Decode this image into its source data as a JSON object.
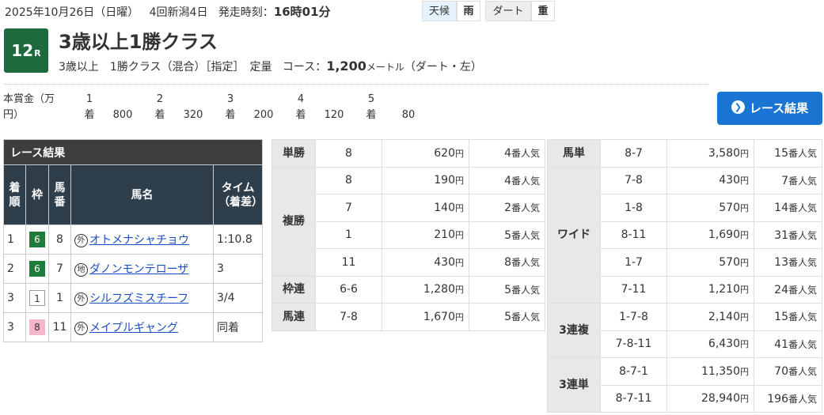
{
  "header": {
    "date": "2025年10月26日（日曜）",
    "meeting": "4回新潟4日",
    "start_label": "発走時刻：",
    "start_time": "16時01分",
    "weather_label": "天候",
    "weather_value": "雨",
    "track_label": "ダート",
    "track_value": "重"
  },
  "race": {
    "number": "12",
    "number_suffix": "R",
    "title": "3歳以上1勝クラス",
    "sub_class": "3歳以上　1勝クラス（混合）［指定］　定量",
    "course_label": "コース：",
    "distance": "1,200",
    "distance_unit": "メートル",
    "course_type": "（ダート・左）"
  },
  "prize": {
    "label_top": "本賞金（万",
    "label_bottom": "円）",
    "items": [
      {
        "rank": "1",
        "suffix": "着",
        "amount": "800"
      },
      {
        "rank": "2",
        "suffix": "着",
        "amount": "320"
      },
      {
        "rank": "3",
        "suffix": "着",
        "amount": "200"
      },
      {
        "rank": "4",
        "suffix": "着",
        "amount": "120"
      },
      {
        "rank": "5",
        "suffix": "着",
        "amount": "80"
      }
    ]
  },
  "result_button": {
    "label": "レース結果"
  },
  "results": {
    "caption": "レース結果",
    "headers": [
      "着順",
      "枠",
      "馬番",
      "馬名",
      "タイム（着差）"
    ],
    "rows": [
      {
        "rank": "1",
        "waku": "6",
        "num": "8",
        "mark": "外",
        "horse": "オトメナシャチョウ",
        "time": "1:10.8"
      },
      {
        "rank": "2",
        "waku": "6",
        "num": "7",
        "mark": "地",
        "horse": "ダノンモンテローザ",
        "time": "3"
      },
      {
        "rank": "3",
        "waku": "1",
        "num": "1",
        "mark": "外",
        "horse": "シルフズミスチーフ",
        "time": "3/4"
      },
      {
        "rank": "3",
        "waku": "8",
        "num": "11",
        "mark": "外",
        "horse": "メイプルギャング",
        "time": "同着"
      }
    ]
  },
  "payout_left": {
    "tansho": {
      "label": "単勝",
      "combo": "8",
      "amount": "620",
      "pop": "4"
    },
    "fukusho": {
      "label": "複勝",
      "rows": [
        {
          "combo": "8",
          "amount": "190",
          "pop": "4"
        },
        {
          "combo": "7",
          "amount": "140",
          "pop": "2"
        },
        {
          "combo": "1",
          "amount": "210",
          "pop": "5"
        },
        {
          "combo": "11",
          "amount": "430",
          "pop": "8"
        }
      ]
    },
    "wakuren": {
      "label": "枠連",
      "combo": "6-6",
      "amount": "1,280",
      "pop": "5"
    },
    "umaren": {
      "label": "馬連",
      "combo": "7-8",
      "amount": "1,670",
      "pop": "5"
    }
  },
  "payout_right": {
    "umatan": {
      "label": "馬単",
      "combo": "8-7",
      "amount": "3,580",
      "pop": "15"
    },
    "wide": {
      "label": "ワイド",
      "rows": [
        {
          "combo": "7-8",
          "amount": "430",
          "pop": "7"
        },
        {
          "combo": "1-8",
          "amount": "570",
          "pop": "14"
        },
        {
          "combo": "8-11",
          "amount": "1,690",
          "pop": "31"
        },
        {
          "combo": "1-7",
          "amount": "570",
          "pop": "13"
        },
        {
          "combo": "7-11",
          "amount": "1,210",
          "pop": "24"
        }
      ]
    },
    "sanrenpuku": {
      "label": "3連複",
      "rows": [
        {
          "combo": "1-7-8",
          "amount": "2,140",
          "pop": "15"
        },
        {
          "combo": "7-8-11",
          "amount": "6,430",
          "pop": "41"
        }
      ]
    },
    "sanrentan": {
      "label": "3連単",
      "rows": [
        {
          "combo": "8-7-1",
          "amount": "11,350",
          "pop": "70"
        },
        {
          "combo": "8-7-11",
          "amount": "28,940",
          "pop": "196"
        }
      ]
    }
  },
  "units": {
    "yen": "円",
    "pop_suffix": "番人気"
  },
  "colors": {
    "waku6": "#1e7b3a",
    "waku8": "#f5b6c9",
    "button": "#1a75d2",
    "race_badge": "#1e6a3c"
  }
}
